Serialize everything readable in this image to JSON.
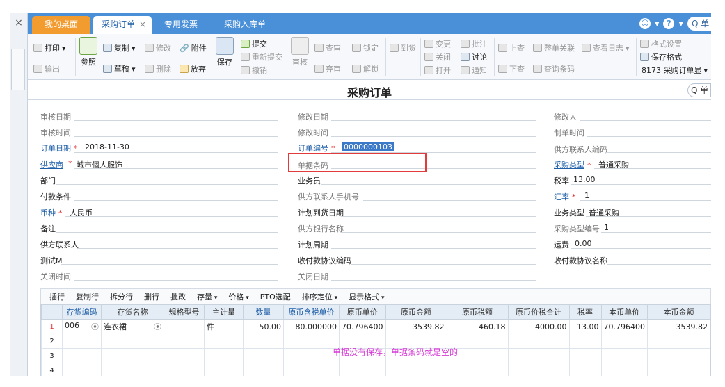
{
  "tabs": {
    "desktop": "我的桌面",
    "purchase_order": "采购订单",
    "special_invoice": "专用发票",
    "purchase_receipt": "采购入库单",
    "close": "×"
  },
  "top_right": {
    "smile": "☺",
    "help": "?",
    "search": "Q 单"
  },
  "left": {
    "close": "×"
  },
  "ribbon": {
    "print": "打印",
    "export": "输出",
    "refer": "参照",
    "copy": "复制",
    "draft": "草稿",
    "modify": "修改",
    "delete": "删除",
    "attach": "附件",
    "discard": "放弃",
    "save": "保存",
    "submit": "提交",
    "resubmit": "重新提交",
    "revoke": "撤销",
    "audit": "审核",
    "query": "查审",
    "abandon": "弃审",
    "lock": "锁定",
    "unlock": "解锁",
    "arrival": "到货",
    "change": "变更",
    "close": "关闭",
    "open": "打开",
    "annotate": "批注",
    "discuss": "讨论",
    "notify": "通知",
    "prev": "上查",
    "next": "下查",
    "whole_link": "整单关联",
    "query_barcode": "查询条码",
    "view_log": "查看日志",
    "format_settings": "格式设置",
    "save_format": "保存格式",
    "format_select": "8173 采购订单显"
  },
  "page_title": "采购订单",
  "title_search": "Q 单",
  "form": {
    "audit_date": "审核日期",
    "modify_date": "修改日期",
    "modifier": "修改人",
    "audit_time": "审核时间",
    "modify_time": "修改时间",
    "maker_time": "制单时间",
    "order_date_label": "订单日期",
    "order_date": "2018-11-30",
    "order_no_label": "订单编号",
    "order_no": "0000000103",
    "supplier_contact_code": "供方联系人编码",
    "supplier_label": "供应商",
    "supplier": "城市個人服饰",
    "doc_barcode": "单据条码",
    "purchase_type_label": "采购类型",
    "purchase_type": "普通采购",
    "dept": "部门",
    "salesman": "业务员",
    "tax_rate_label": "税率",
    "tax_rate": "13.00",
    "payment_terms": "付款条件",
    "supplier_contact_phone": "供方联系人手机号",
    "exchange_rate_label": "汇率",
    "exchange_rate": "1",
    "currency_label": "币种",
    "currency": "人民币",
    "planned_arrival": "计划到货日期",
    "business_type_label": "业务类型",
    "business_type": "普通采购",
    "remark": "备注",
    "supplier_bank": "供方银行名称",
    "purchase_type_no_label": "采购类型编号",
    "purchase_type_no": "1",
    "supplier_contact": "供方联系人",
    "plan_period": "计划周期",
    "freight_label": "运费",
    "freight": "0.00",
    "test_m": "测试M",
    "payment_protocol_code": "收付款协议编码",
    "payment_protocol_name": "收付款协议名称",
    "close_time": "关闭时间",
    "close_date": "关闭日期"
  },
  "grid_toolbar": [
    "插行",
    "复制行",
    "拆分行",
    "删行",
    "批改",
    "存量",
    "价格",
    "PTO选配",
    "排序定位",
    "显示格式"
  ],
  "grid": {
    "columns": [
      "",
      "存货编码",
      "存货名称",
      "规格型号",
      "主计量",
      "数量",
      "原币含税单价",
      "原币单价",
      "原币金额",
      "原币税额",
      "原币价税合计",
      "税率",
      "本币单价",
      "本币金额"
    ],
    "rows": [
      [
        "1",
        "006",
        "连衣裙",
        "",
        "件",
        "50.00",
        "80.000000",
        "70.796400",
        "3539.82",
        "460.18",
        "4000.00",
        "13.00",
        "70.796400",
        "3539.82"
      ],
      [
        "2",
        "",
        "",
        "",
        "",
        "",
        "",
        "",
        "",
        "",
        "",
        "",
        "",
        ""
      ],
      [
        "3",
        "",
        "",
        "",
        "",
        "",
        "",
        "",
        "",
        "",
        "",
        "",
        "",
        ""
      ],
      [
        "4",
        "",
        "",
        "",
        "",
        "",
        "",
        "",
        "",
        "",
        "",
        "",
        "",
        ""
      ]
    ]
  },
  "note": "单据没有保存，单据条码就是空的"
}
